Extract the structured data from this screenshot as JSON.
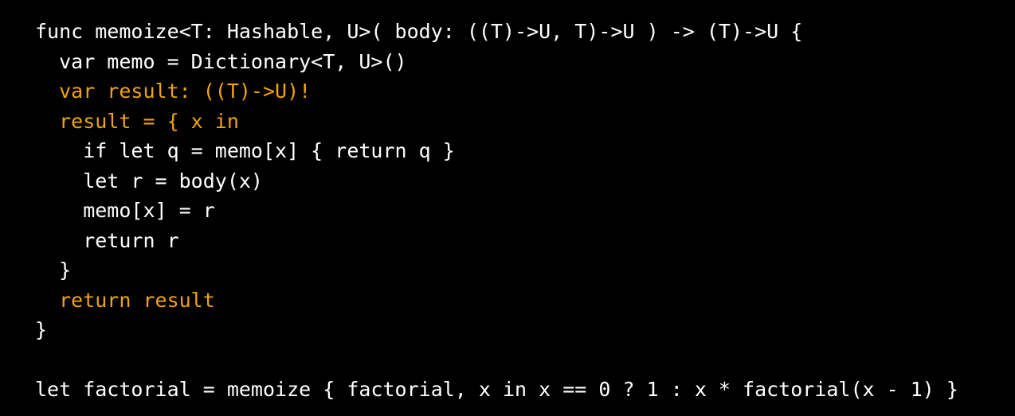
{
  "colors": {
    "background": "#000000",
    "text": "#ffffff",
    "highlight": "#f0a30a"
  },
  "code": {
    "lines": [
      {
        "text": "func memoize<T: Hashable, U>( body: ((T)->U, T)->U ) -> (T)->U {",
        "highlighted": false
      },
      {
        "text": "  var memo = Dictionary<T, U>()",
        "highlighted": false
      },
      {
        "text": "  var result: ((T)->U)!",
        "highlighted": true
      },
      {
        "text": "  result = { x in",
        "highlighted": true
      },
      {
        "text": "    if let q = memo[x] { return q }",
        "highlighted": false
      },
      {
        "text": "    let r = body(x)",
        "highlighted": false
      },
      {
        "text": "    memo[x] = r",
        "highlighted": false
      },
      {
        "text": "    return r",
        "highlighted": false
      },
      {
        "text": "  }",
        "highlighted": false
      },
      {
        "text": "  return result",
        "highlighted": true
      },
      {
        "text": "}",
        "highlighted": false
      },
      {
        "text": "",
        "highlighted": false
      },
      {
        "text": "let factorial = memoize { factorial, x in x == 0 ? 1 : x * factorial(x - 1) }",
        "highlighted": false
      }
    ]
  }
}
